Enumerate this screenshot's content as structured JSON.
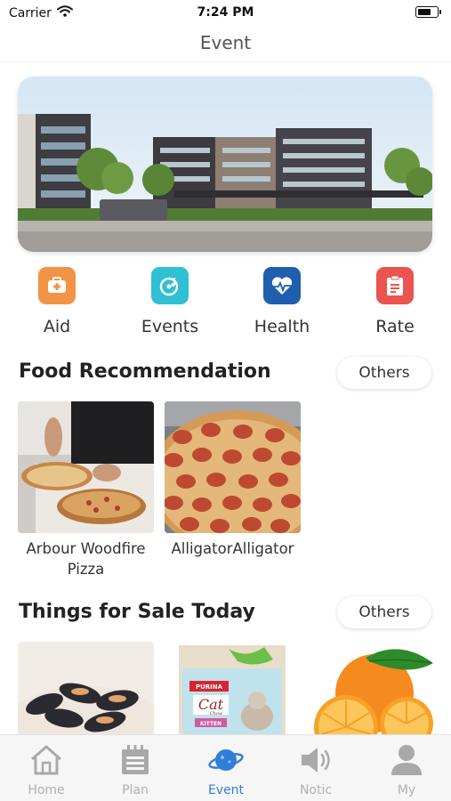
{
  "status_bar": {
    "carrier": "Carrier",
    "time": "7:24 PM"
  },
  "nav": {
    "title": "Event"
  },
  "quick_menu": [
    {
      "label": "Aid",
      "icon": "first-aid-icon",
      "color": "#f39345"
    },
    {
      "label": "Events",
      "icon": "music-disc-icon",
      "color": "#2fc0d4"
    },
    {
      "label": "Health",
      "icon": "heartbeat-icon",
      "color": "#1f5fae"
    },
    {
      "label": "Rate",
      "icon": "clipboard-icon",
      "color": "#ec5450"
    }
  ],
  "food_section": {
    "title": "Food Recommendation",
    "others_label": "Others",
    "items": [
      {
        "name": "Arbour Woodfire Pizza"
      },
      {
        "name": "AlligatorAlligator"
      }
    ]
  },
  "sale_section": {
    "title": "Things for Sale Today",
    "others_label": "Others",
    "items": [
      {
        "image": "mussels"
      },
      {
        "image": "cat-food-bag",
        "brand": "PURINA",
        "product": "Cat",
        "product_sub": "Chow",
        "variant": "KITTEN"
      },
      {
        "image": "oranges"
      }
    ]
  },
  "tab_bar": [
    {
      "label": "Home",
      "icon": "home-icon",
      "active": false
    },
    {
      "label": "Plan",
      "icon": "calendar-icon",
      "active": false
    },
    {
      "label": "Event",
      "icon": "planet-icon",
      "active": true
    },
    {
      "label": "Notic",
      "icon": "speaker-icon",
      "active": false
    },
    {
      "label": "My",
      "icon": "user-icon",
      "active": false
    }
  ],
  "colors": {
    "accent": "#2f7fd8",
    "inactive_tab": "#b0b0b0"
  }
}
